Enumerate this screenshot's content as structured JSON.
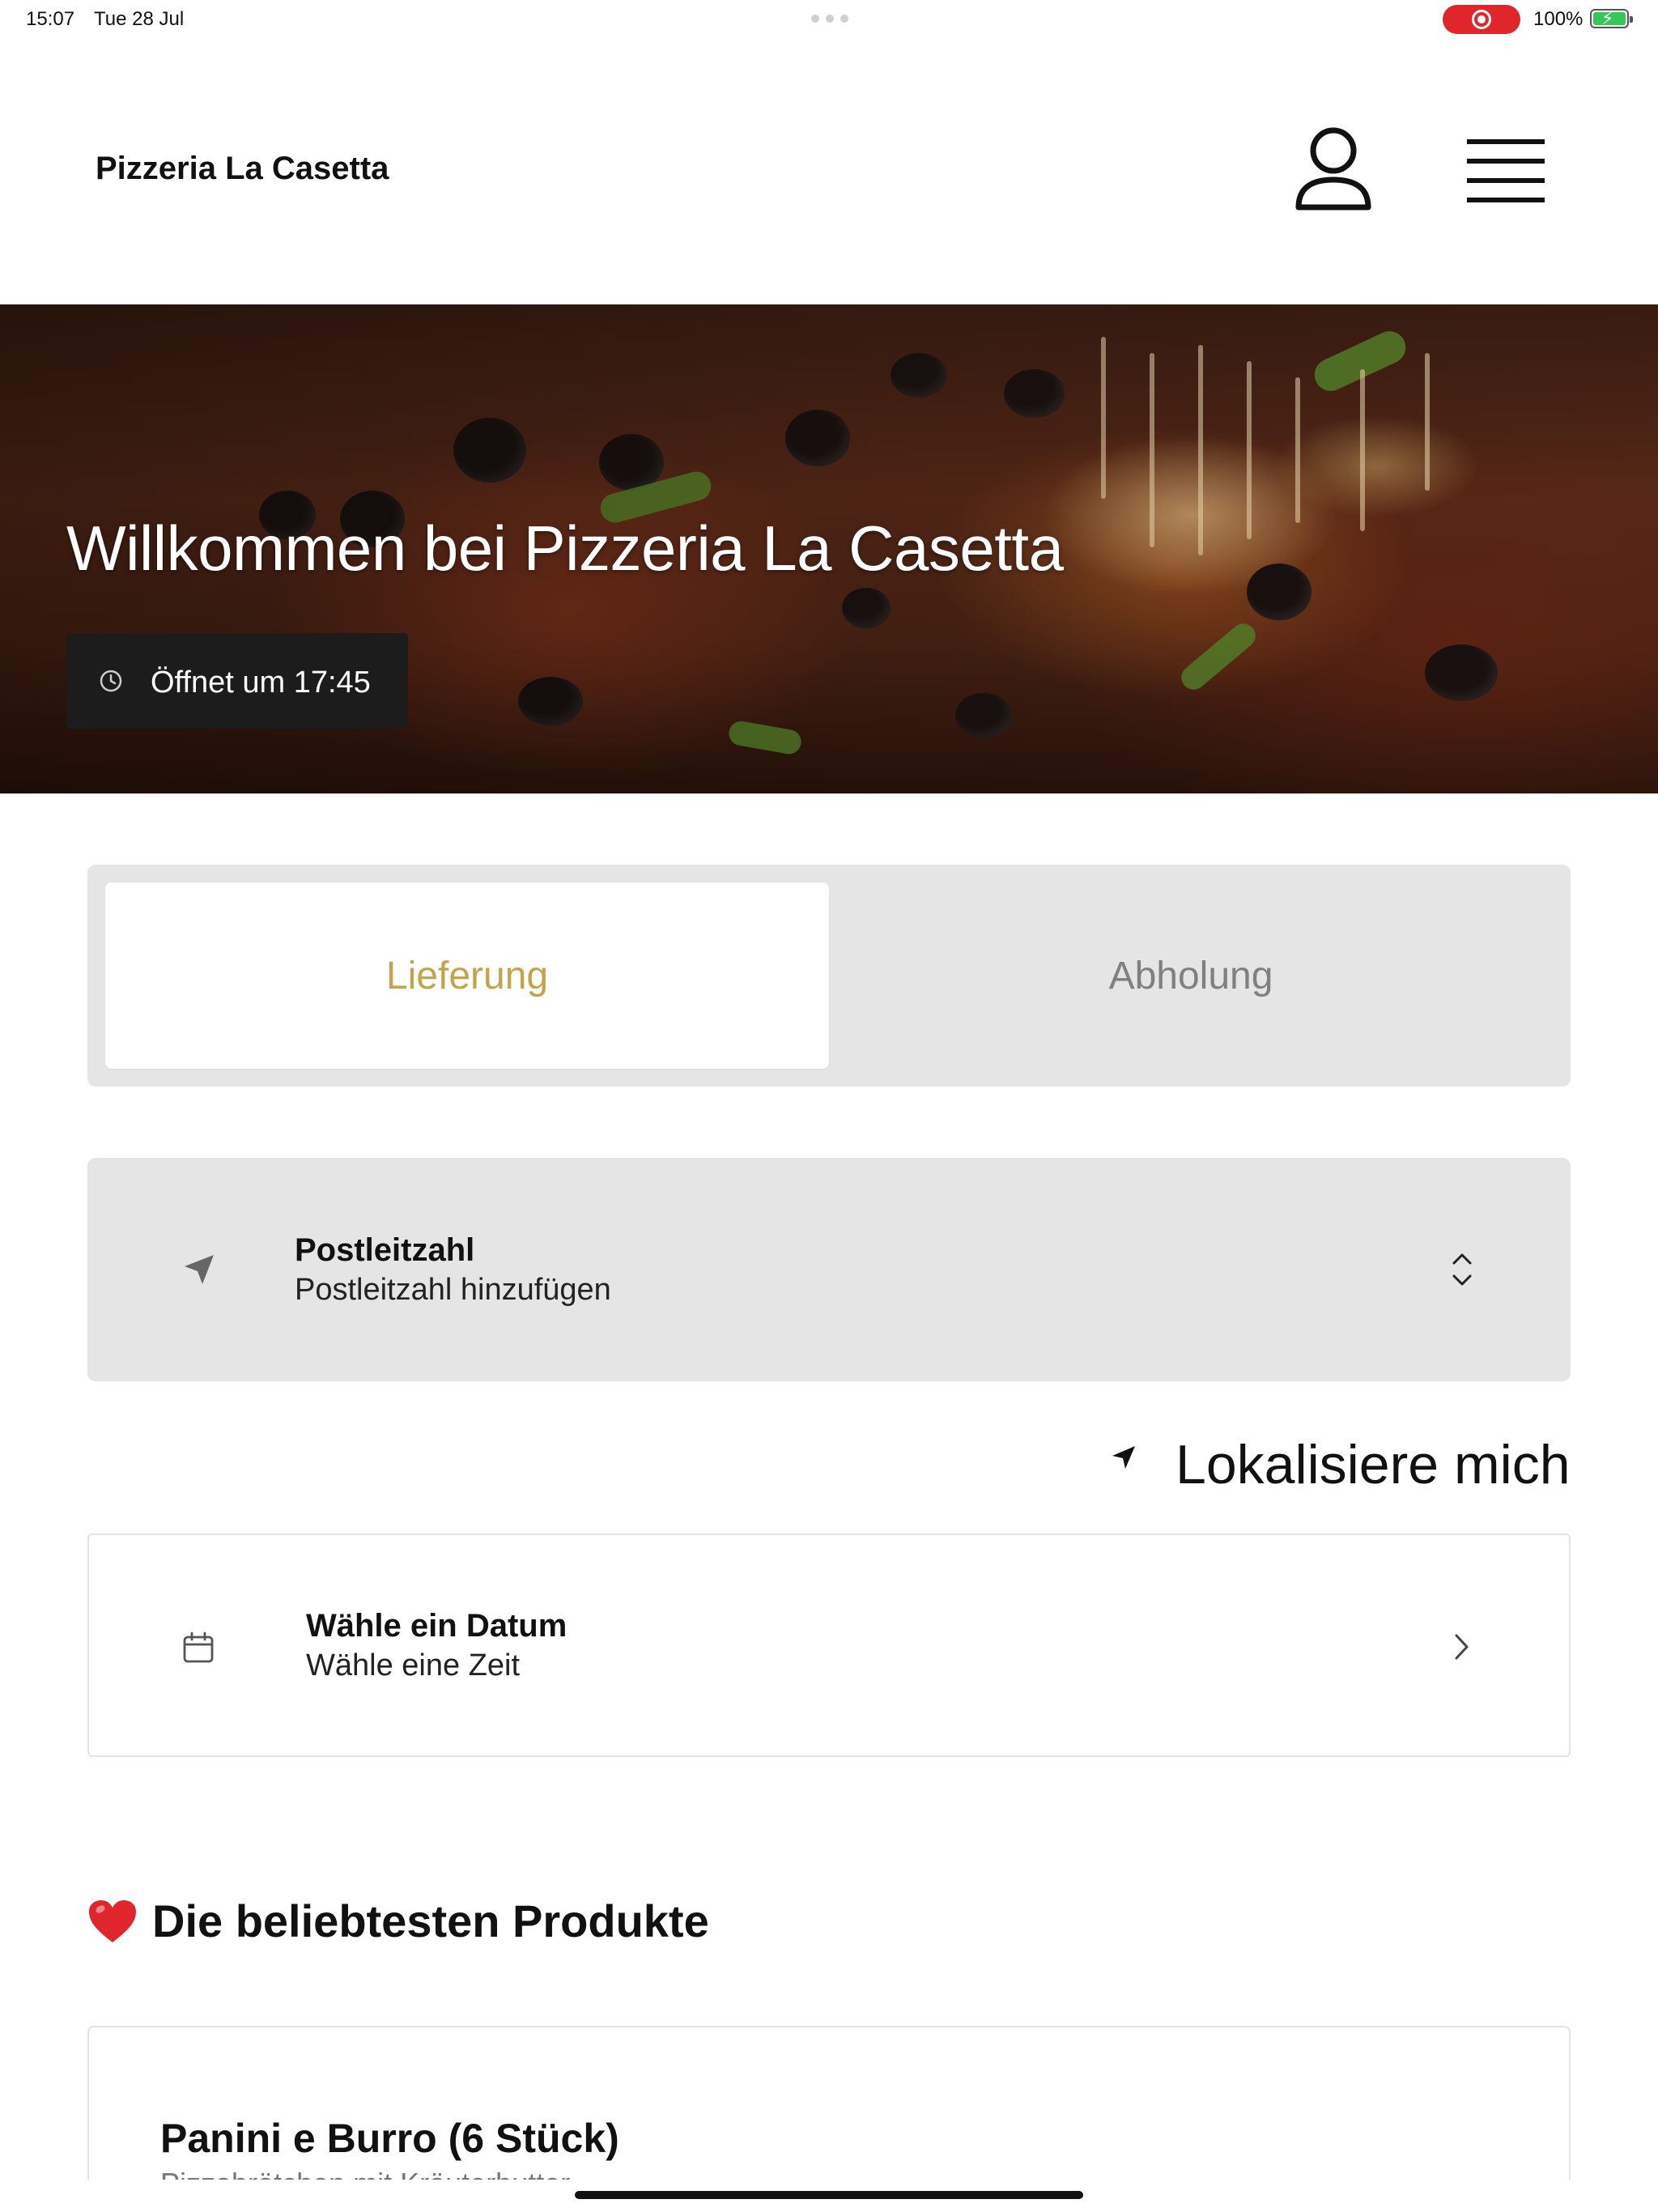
{
  "status_bar": {
    "time": "15:07",
    "date": "Tue 28 Jul",
    "battery": "100%",
    "recording_color": "#e0262b",
    "battery_color": "#35c759"
  },
  "header": {
    "brand": "Pizzeria La Casetta",
    "user_icon": "user-icon",
    "menu_icon": "hamburger-menu-icon"
  },
  "hero": {
    "title": "Willkommen bei Pizzeria La Casetta",
    "opening": "Öffnet um 17:45",
    "opening_icon": "clock-icon"
  },
  "tabs": [
    {
      "label": "Lieferung",
      "active": true,
      "color": "#c4a44a"
    },
    {
      "label": "Abholung",
      "active": false,
      "color": "#808080"
    }
  ],
  "postcode": {
    "label": "Postleitzahl",
    "value": "Postleitzahl hinzufügen",
    "icon": "navigation-arrow-icon",
    "toggle_icon": "chevron-up-down-icon"
  },
  "locate": {
    "label": "Lokalisiere mich",
    "icon": "location-arrow-icon"
  },
  "date": {
    "label": "Wähle ein Datum",
    "value": "Wähle eine Zeit",
    "icon": "calendar-icon",
    "chevron_icon": "chevron-right-icon"
  },
  "popular": {
    "title": "Die beliebtesten Produkte",
    "icon": "heart-icon"
  },
  "product": {
    "name": "Panini e Burro (6 Stück)",
    "description": "Pizzabrötchen mit Kräuterbutter"
  }
}
